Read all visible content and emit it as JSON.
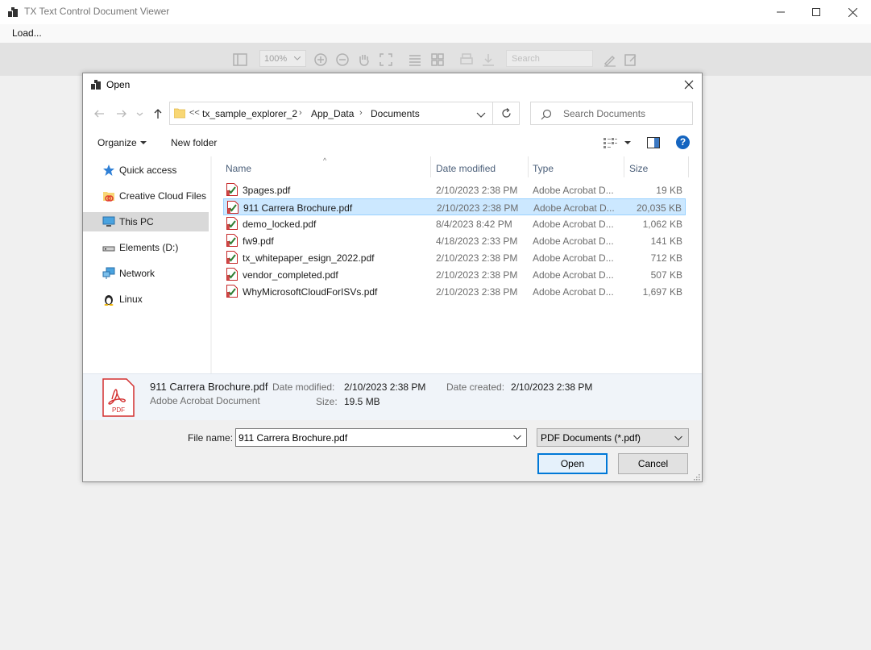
{
  "app": {
    "title": "TX Text Control Document Viewer",
    "menu_load": "Load...",
    "zoom_value": "100%",
    "search_placeholder": "Search"
  },
  "dialog": {
    "title": "Open",
    "breadcrumb": {
      "overflow": "<<",
      "items": [
        "tx_sample_explorer_2",
        "App_Data",
        "Documents"
      ]
    },
    "search_placeholder": "Search Documents",
    "organize_label": "Organize",
    "new_folder_label": "New folder",
    "nav_items": [
      {
        "label": "Quick access",
        "icon": "star-icon"
      },
      {
        "label": "Creative Cloud Files",
        "icon": "creative-cloud-icon"
      },
      {
        "label": "This PC",
        "icon": "computer-icon"
      },
      {
        "label": "Elements (D:)",
        "icon": "drive-icon"
      },
      {
        "label": "Network",
        "icon": "network-icon"
      },
      {
        "label": "Linux",
        "icon": "linux-icon"
      }
    ],
    "columns": {
      "name": "Name",
      "date": "Date modified",
      "type": "Type",
      "size": "Size"
    },
    "files": [
      {
        "name": "3pages.pdf",
        "date": "2/10/2023 2:38 PM",
        "type": "Adobe Acrobat D...",
        "size": "19 KB"
      },
      {
        "name": "911 Carrera Brochure.pdf",
        "date": "2/10/2023 2:38 PM",
        "type": "Adobe Acrobat D...",
        "size": "20,035 KB"
      },
      {
        "name": "demo_locked.pdf",
        "date": "8/4/2023 8:42 PM",
        "type": "Adobe Acrobat D...",
        "size": "1,062 KB"
      },
      {
        "name": "fw9.pdf",
        "date": "4/18/2023 2:33 PM",
        "type": "Adobe Acrobat D...",
        "size": "141 KB"
      },
      {
        "name": "tx_whitepaper_esign_2022.pdf",
        "date": "2/10/2023 2:38 PM",
        "type": "Adobe Acrobat D...",
        "size": "712 KB"
      },
      {
        "name": "vendor_completed.pdf",
        "date": "2/10/2023 2:38 PM",
        "type": "Adobe Acrobat D...",
        "size": "507 KB"
      },
      {
        "name": "WhyMicrosoftCloudForISVs.pdf",
        "date": "2/10/2023 2:38 PM",
        "type": "Adobe Acrobat D...",
        "size": "1,697 KB"
      }
    ],
    "details": {
      "name": "911 Carrera Brochure.pdf",
      "type": "Adobe Acrobat Document",
      "date_modified_label": "Date modified:",
      "date_modified": "2/10/2023 2:38 PM",
      "size_label": "Size:",
      "size": "19.5 MB",
      "date_created_label": "Date created:",
      "date_created": "2/10/2023 2:38 PM",
      "icon_text": "PDF"
    },
    "file_name_label": "File name:",
    "file_name_value": "911 Carrera Brochure.pdf",
    "filter_value": "PDF Documents (*.pdf)",
    "open_label": "Open",
    "cancel_label": "Cancel"
  },
  "colors": {
    "selection": "#cce8ff",
    "selection_border": "#99d1ff",
    "primary_border": "#0078d7",
    "pdf_red": "#d32f2f",
    "help_blue": "#1565c0"
  }
}
